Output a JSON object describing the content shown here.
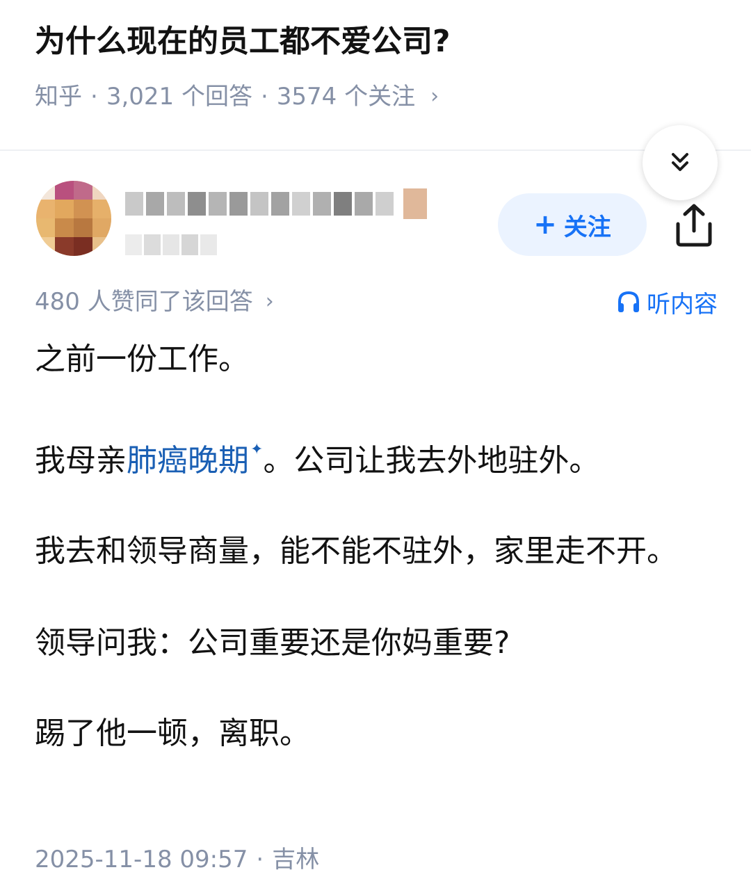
{
  "question": {
    "title": "为什么现在的员工都不爱公司?",
    "source": "知乎",
    "separator": "·",
    "answers_count": "3,021 个回答",
    "followers_count": "3574 个关注",
    "chevron": "›"
  },
  "author": {
    "avatar_icon": "avatar-pixelated",
    "follow_label": "关注",
    "follow_plus": "+",
    "share_icon": "share-icon",
    "collapse_icon": "double-chevron-down-icon"
  },
  "answer": {
    "vote_text": "480 人赞同了该回答",
    "vote_chevron": "›",
    "listen_label": "听内容",
    "paragraphs": {
      "p1": "之前一份工作。",
      "p2_before": "我母亲",
      "p2_keyword": "肺癌晚期",
      "p2_keyword_mark": "✦",
      "p2_after": "。公司让我去外地驻外。",
      "p3": "我去和领导商量，能不能不驻外，家里走不开。",
      "p4": "领导问我：公司重要还是你妈重要?",
      "p5": "踢了他一顿，离职。"
    },
    "timestamp": "2025-11-18 09:57",
    "location": "吉林",
    "separator": "·"
  },
  "colors": {
    "link_blue": "#1772f6",
    "meta_gray": "#8590a6",
    "follow_bg": "#ebf3ff",
    "text": "#121212"
  }
}
